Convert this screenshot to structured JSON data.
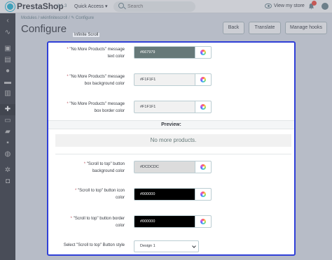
{
  "topbar": {
    "brand": "PrestaShop",
    "version": "8.1.3",
    "quick_access": "Quick Access ▾",
    "search_placeholder": "Search",
    "view_store": "View my store",
    "notifications": ""
  },
  "header": {
    "breadcrumb": "Modules  /  wkinfinitescroll  /  ✎ Configure",
    "title": "Configure",
    "buttons": {
      "back": "Back",
      "translate": "Translate",
      "hooks": "Manage hooks"
    }
  },
  "modal": {
    "title": "Infinite Scroll",
    "fields": [
      {
        "label_line1": "\"No More Products\" message",
        "label_line2": "text color",
        "value": "#667979",
        "swatch": "#667979",
        "text_color": "#ffffff"
      },
      {
        "label_line1": "\"No More Products\" message",
        "label_line2": "box background color",
        "value": "#F1F1F1",
        "swatch": "#F1F1F1",
        "text_color": "#363a41"
      },
      {
        "label_line1": "\"No More Products\" message",
        "label_line2": "box border color",
        "value": "#F1F1F1",
        "swatch": "#F1F1F1",
        "text_color": "#363a41"
      }
    ],
    "preview_heading": "Preview:",
    "preview_text": "No more products.",
    "scroll_fields": [
      {
        "label_line1": "\"Scroll to top\" button",
        "label_line2": "background color",
        "value": "#DCDCDC",
        "swatch": "#DCDCDC",
        "text_color": "#363a41"
      },
      {
        "label_line1": "\"Scroll to top\" button icon",
        "label_line2": "color",
        "value": "#000000",
        "swatch": "#000000",
        "text_color": "#ffffff"
      },
      {
        "label_line1": "\"Scroll to top\" button border",
        "label_line2": "color",
        "value": "#000000",
        "swatch": "#000000",
        "text_color": "#ffffff"
      }
    ],
    "style_label": "Select \"Scroll to top\" Button style",
    "style_value": "Design 1"
  },
  "colors": {
    "accent": "#25b9d7",
    "modal_border": "#2f3fd7",
    "required": "#c05c67"
  }
}
